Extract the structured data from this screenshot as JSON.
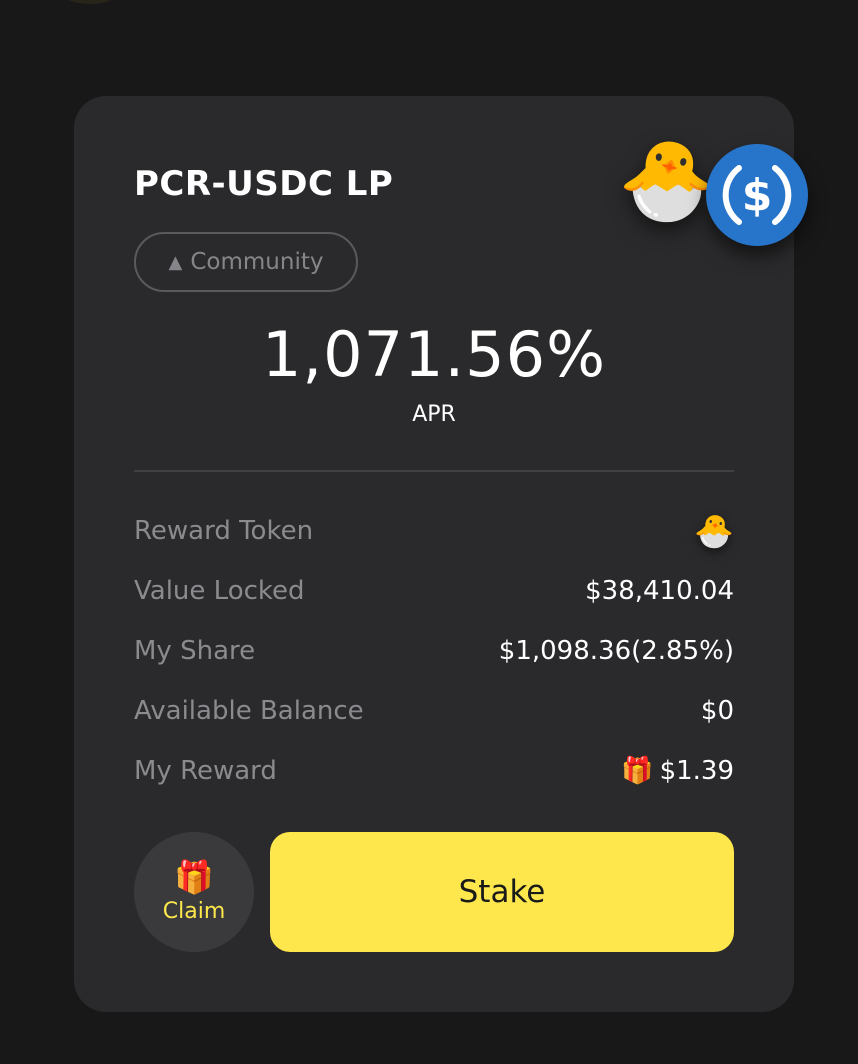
{
  "card": {
    "title": "PCR-USDC LP",
    "badge": {
      "icon": "warning-icon",
      "label": "Community"
    },
    "apr": {
      "value": "1,071.56%",
      "label": "APR"
    },
    "token_icons": [
      "chick-icon",
      "usdc-icon"
    ],
    "rows": [
      {
        "label": "Reward Token",
        "value": "",
        "icon": "chick-icon"
      },
      {
        "label": "Value Locked",
        "value": "$38,410.04"
      },
      {
        "label": "My Share",
        "value": "$1,098.36(2.85%)"
      },
      {
        "label": "Available Balance",
        "value": "$0"
      },
      {
        "label": "My Reward",
        "value": "$1.39",
        "icon": "gift-icon"
      }
    ],
    "actions": {
      "claim_label": "Claim",
      "stake_label": "Stake"
    }
  },
  "colors": {
    "background": "#181818",
    "card": "#2a2a2c",
    "accent_yellow": "#fde74c",
    "usdc_blue": "#2775ca",
    "muted_text": "#8b8b8f"
  }
}
